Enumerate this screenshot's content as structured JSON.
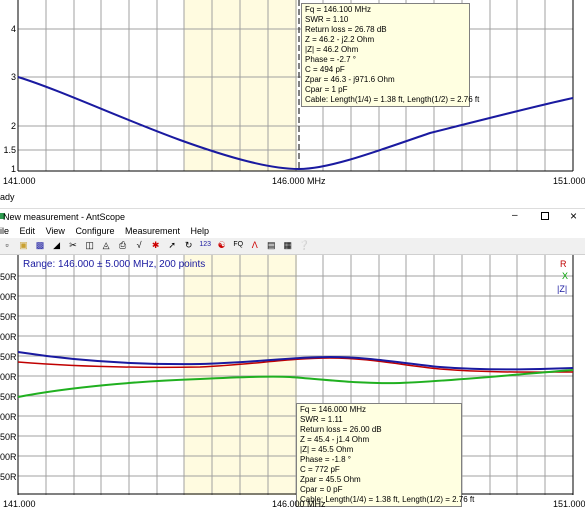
{
  "top_chart": {
    "y_ticks": [
      "4",
      "3",
      "2",
      "1.5",
      "1"
    ],
    "x_ticks": [
      "141.000",
      "146.000 MHz",
      "151.000"
    ],
    "status_text": "ady",
    "tooltip": [
      "Fq = 146.100 MHz",
      "SWR = 1.10",
      "Return loss = 26.78 dB",
      "Z = 46.2 - j2.2 Ohm",
      "|Z| = 46.2 Ohm",
      "Phase = -2.7 °",
      "C = 494 pF",
      "Zpar = 46.3 - j971.6 Ohm",
      "Cpar = 1 pF",
      "Cable: Length(1/4) = 1.38 ft, Length(1/2) = 2.76 ft"
    ],
    "colors": {
      "swr": "#1a1aa0",
      "band": "#fffbe0",
      "grid": "#a0a0a0"
    }
  },
  "window": {
    "title": "New measurement - AntScope",
    "menu": [
      "ile",
      "Edit",
      "View",
      "Configure",
      "Measurement",
      "Help"
    ],
    "toolbar_icons": [
      "open-icon",
      "folder-icon",
      "save-icon",
      "calibrate-icon",
      "cut-icon",
      "copy-icon",
      "paste-icon",
      "print-icon",
      "chart-icon",
      "magnet-icon",
      "cursor-icon",
      "refresh-icon",
      "123-icon",
      "antenna-icon",
      "fq-icon",
      "zoom-icon",
      "graph-icon",
      "export-icon",
      "help-icon"
    ],
    "controls": [
      "minimize-icon",
      "restore-icon",
      "close-icon"
    ]
  },
  "bottom_chart": {
    "range_label": "Range: 146.000 ± 5.000 MHz, 200 points",
    "y_ticks": [
      "50R",
      "00R",
      "50R",
      "00R",
      "50R",
      "00R",
      "50R",
      "00R",
      "50R",
      "00R",
      "50R"
    ],
    "x_ticks": [
      "141.000",
      "146.000 MHz",
      "151.000"
    ],
    "legend": [
      {
        "label": "R",
        "color": "#c00000"
      },
      {
        "label": "X",
        "color": "#00a000"
      },
      {
        "label": "|Z|",
        "color": "#1a1aa0"
      }
    ],
    "tooltip": [
      "Fq = 146.000 MHz",
      "SWR = 1.11",
      "Return loss = 26.00 dB",
      "Z = 45.4 - j1.4 Ohm",
      "|Z| = 45.5 Ohm",
      "Phase = -1.8 °",
      "C = 772 pF",
      "Zpar = 45.5 Ohm",
      "Cpar = 0 pF",
      "Cable: Length(1/4) = 1.38 ft, Length(1/2) = 2.76 ft"
    ]
  }
}
